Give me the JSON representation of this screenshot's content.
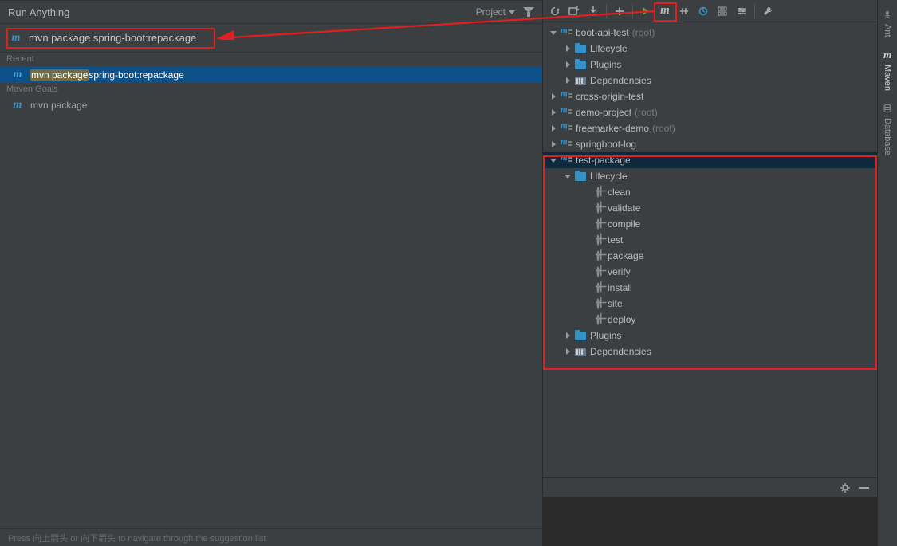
{
  "run_anything": {
    "title": "Run Anything",
    "project_filter": "Project",
    "search_command": "mvn package spring-boot:repackage",
    "recent_label": "Recent",
    "recent_highlight": "mvn package",
    "recent_rest": " spring-boot:repackage",
    "goals_label": "Maven Goals",
    "goal_item": "mvn package",
    "footer_hint": "Press 向上箭头 or 向下箭头 to navigate through the suggestion list"
  },
  "toolbar_icons": [
    "refresh-icon",
    "generate-sources-icon",
    "download-sources-icon",
    "add-icon",
    "play-icon",
    "maven-goal-icon",
    "toggle-offline-icon",
    "reimport-icon",
    "collapse-all-icon",
    "settings-layout-icon",
    "wrench-icon"
  ],
  "maven_tree": {
    "modules": [
      {
        "name": "boot-api-test",
        "suffix": "(root)",
        "expanded": true,
        "children": [
          {
            "name": "Lifecycle",
            "icon": "folder",
            "expanded": false
          },
          {
            "name": "Plugins",
            "icon": "folder",
            "expanded": false
          },
          {
            "name": "Dependencies",
            "icon": "deps",
            "expanded": false
          }
        ]
      },
      {
        "name": "cross-origin-test",
        "suffix": "",
        "expanded": false
      },
      {
        "name": "demo-project",
        "suffix": "(root)",
        "expanded": false
      },
      {
        "name": "freemarker-demo",
        "suffix": "(root)",
        "expanded": false
      },
      {
        "name": "springboot-log",
        "suffix": "",
        "expanded": false
      },
      {
        "name": "test-package",
        "suffix": "",
        "expanded": true,
        "selected": true,
        "children": [
          {
            "name": "Lifecycle",
            "icon": "folder",
            "expanded": true,
            "goals": [
              "clean",
              "validate",
              "compile",
              "test",
              "package",
              "verify",
              "install",
              "site",
              "deploy"
            ]
          },
          {
            "name": "Plugins",
            "icon": "folder",
            "expanded": false
          },
          {
            "name": "Dependencies",
            "icon": "deps",
            "expanded": false
          }
        ]
      }
    ]
  },
  "side_tabs": [
    {
      "label": "Ant",
      "icon": "ant-icon"
    },
    {
      "label": "Maven",
      "icon": "maven-icon",
      "active": true
    },
    {
      "label": "Database",
      "icon": "database-icon"
    }
  ]
}
